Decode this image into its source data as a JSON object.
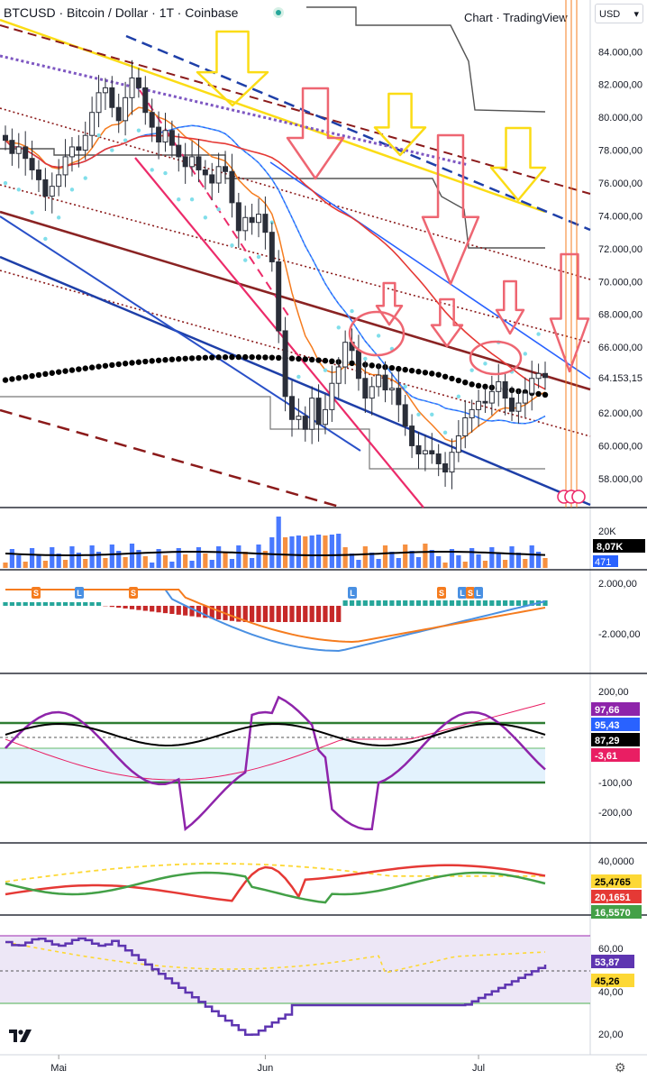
{
  "header": {
    "title": "BTCUSD · Bitcoin / Dollar · 1T · Coinbase",
    "credit": "Chart · TradingView",
    "currency": "USD"
  },
  "colors": {
    "up": "#2a2e39",
    "down": "#2a2e39",
    "ema_orange": "#f57c1f",
    "ma_blue": "#2962ff",
    "ma_red": "#e53935",
    "yellow": "#fbdc15",
    "dark_red": "#8b1a1a",
    "pink": "#ec2b6a",
    "navy": "#1e3fa8",
    "purple": "#7e57c2",
    "green": "#2e7d32"
  },
  "chart_data": [
    {
      "type": "candlestick",
      "panel": "price",
      "x_labels": [
        "Mai",
        "Jun",
        "Jul"
      ],
      "x_label_index": [
        8,
        39,
        71
      ],
      "count": 82,
      "ylim": [
        56400,
        85500
      ],
      "y_ticks": [
        {
          "value": 84000,
          "label": "84.000,00"
        },
        {
          "value": 82000,
          "label": "82.000,00"
        },
        {
          "value": 80000,
          "label": "80.000,00"
        },
        {
          "value": 78000,
          "label": "78.000,00"
        },
        {
          "value": 76000,
          "label": "76.000,00"
        },
        {
          "value": 74000,
          "label": "74.000,00"
        },
        {
          "value": 72000,
          "label": "72.000,00"
        },
        {
          "value": 70000,
          "label": "70.000,00"
        },
        {
          "value": 68000,
          "label": "68.000,00"
        },
        {
          "value": 66000,
          "label": "66.000,00"
        },
        {
          "value": 62000,
          "label": "62.000,00"
        },
        {
          "value": 60000,
          "label": "60.000,00"
        },
        {
          "value": 58000,
          "label": "58.000,00"
        }
      ],
      "last_price": {
        "value": 64153,
        "label": "64.153,15"
      },
      "closes": [
        78600,
        77800,
        78200,
        77500,
        76800,
        76200,
        75200,
        75800,
        76500,
        77600,
        78200,
        78000,
        78900,
        80300,
        81500,
        81800,
        80600,
        79800,
        81200,
        82400,
        81800,
        80300,
        79400,
        78500,
        79200,
        78300,
        77600,
        77000,
        77600,
        76800,
        76500,
        76000,
        77000,
        76700,
        74800,
        73100,
        73900,
        73600,
        74100,
        73000,
        71200,
        67000,
        63000,
        61600,
        61800,
        61000,
        62900,
        61300,
        62200,
        63800,
        64800,
        66300,
        65800,
        64100,
        62900,
        63600,
        64300,
        63400,
        63500,
        62500,
        61200,
        60000,
        59500,
        59700,
        59500,
        58900,
        58400,
        59600,
        60600,
        61700,
        62200,
        62700,
        62600,
        63300,
        63900,
        62900,
        62100,
        62600,
        63200,
        64100,
        64400,
        64153
      ]
    },
    {
      "type": "bar",
      "panel": "volume",
      "labels": [
        "20K",
        "8,07K",
        "471"
      ]
    },
    {
      "type": "line",
      "panel": "macd",
      "y_ticks": [
        "2.000,00",
        "-2.000,00"
      ],
      "markers": [
        "S",
        "L",
        "S",
        "L",
        "S",
        "L",
        "S",
        "L"
      ]
    },
    {
      "type": "line",
      "panel": "cci",
      "y_ticks": [
        "200,00",
        "-100,00",
        "-200,00"
      ],
      "value_labels": [
        "97,66",
        "95,43",
        "87,29",
        "-3,61"
      ]
    },
    {
      "type": "line",
      "panel": "dmi",
      "y_ticks": [
        "40,0000"
      ],
      "value_labels": [
        "25,4765",
        "20,1651",
        "16,5570"
      ]
    },
    {
      "type": "line",
      "panel": "rsi",
      "y_ticks": [
        "60,00",
        "40,00",
        "20,00"
      ],
      "value_labels": [
        "53,87",
        "45,26"
      ]
    }
  ]
}
